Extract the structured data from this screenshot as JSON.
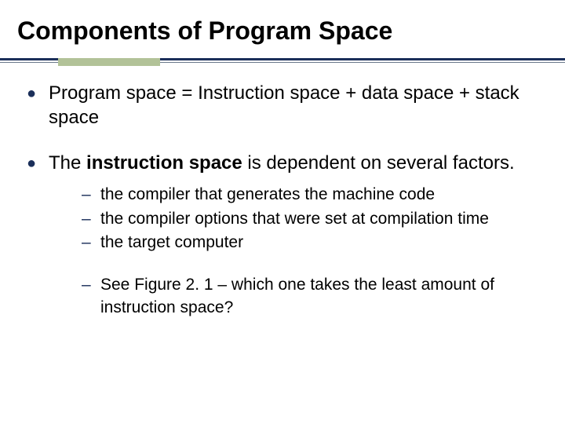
{
  "title": "Components of Program Space",
  "bullets": [
    {
      "text": "Program space = Instruction space + data space + stack space"
    },
    {
      "pre": "The ",
      "bold": "instruction space",
      "post": " is dependent on several factors.",
      "sub": [
        "the compiler that generates the machine code",
        "the compiler options that were set at compilation time",
        "the target computer",
        "See Figure 2. 1 – which one takes the least amount of instruction space?"
      ]
    }
  ]
}
